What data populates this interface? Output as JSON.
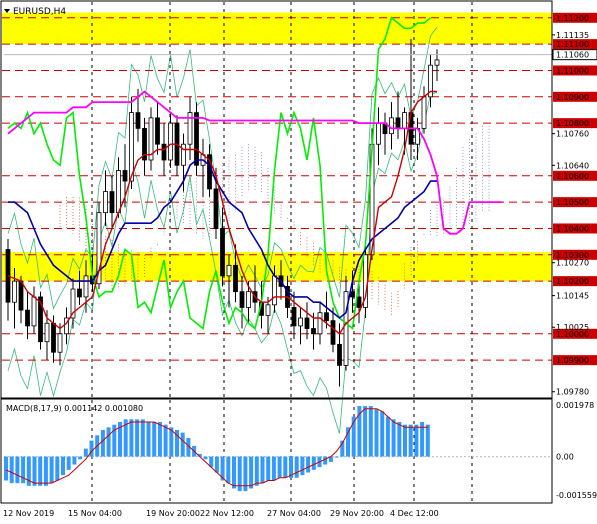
{
  "header": {
    "symbol": "EURUSD,H4"
  },
  "price_axis": {
    "ticks": [
      "1.11135",
      "1.10760",
      "1.10640",
      "1.10270",
      "1.10145",
      "1.10025",
      "1.09780"
    ],
    "current_price": "1.11060",
    "levels": [
      {
        "label": "1.11200",
        "value": 1.112
      },
      {
        "label": "1.11100",
        "value": 1.111
      },
      {
        "label": "1.11000",
        "value": 1.11
      },
      {
        "label": "1.10900",
        "value": 1.109
      },
      {
        "label": "1.10800",
        "value": 1.108
      },
      {
        "label": "1.10600",
        "value": 1.106
      },
      {
        "label": "1.10500",
        "value": 1.105
      },
      {
        "label": "1.10400",
        "value": 1.104
      },
      {
        "label": "1.10300",
        "value": 1.103
      },
      {
        "label": "1.10200",
        "value": 1.102
      },
      {
        "label": "1.10000",
        "value": 1.1
      },
      {
        "label": "1.09900",
        "value": 1.099
      }
    ],
    "highlight_zones": [
      {
        "from": 1.111,
        "to": 1.1122
      },
      {
        "from": 1.102,
        "to": 1.1031
      }
    ]
  },
  "macd": {
    "title": "MACD(8,17,9) 0.001142 0.001080",
    "ticks": [
      "0.001978",
      "0.00",
      "-0.001559"
    ]
  },
  "time_axis": {
    "labels": [
      "12 Nov 2019",
      "15 Nov 04:00",
      "19 Nov 20:00",
      "22 Nov 12:00",
      "27 Nov 04:00",
      "29 Nov 20:00",
      "4 Dec 12:00"
    ]
  },
  "colors": {
    "background": "#ffffff",
    "level_line": "#cc0000",
    "zone_fill": "#ffff00",
    "bull_bear_candle": "#000000",
    "ichimoku_tenkan": "#cc0000",
    "ichimoku_kijun": "#0000aa",
    "chikou": "#00ee00",
    "magenta_line": "#ff00ff",
    "envelope": "#33bb77",
    "cloud_red": "#e07a50",
    "cloud_blue": "#9999cc",
    "macd_hist": "#3399ff",
    "macd_signal": "#cc0000"
  },
  "chart_data": {
    "type": "candlestick",
    "symbol": "EURUSD",
    "timeframe": "H4",
    "candles": [
      [
        1.1032,
        1.1036,
        1.1005,
        1.1012
      ],
      [
        1.1012,
        1.1025,
        1.1002,
        1.102
      ],
      [
        1.102,
        1.1022,
        1.1004,
        1.1009
      ],
      [
        1.1009,
        1.1016,
        1.0998,
        1.1003
      ],
      [
        1.1003,
        1.1018,
        1.1,
        1.1014
      ],
      [
        1.1014,
        1.1016,
        1.0994,
        1.0997
      ],
      [
        1.0997,
        1.1009,
        1.099,
        1.1004
      ],
      [
        1.1004,
        1.1007,
        1.0989,
        1.0993
      ],
      [
        1.0993,
        1.1004,
        1.0988,
        1.1
      ],
      [
        1.1,
        1.101,
        1.0996,
        1.1006
      ],
      [
        1.1006,
        1.1021,
        1.1002,
        1.1017
      ],
      [
        1.1017,
        1.1024,
        1.1011,
        1.1014
      ],
      [
        1.1014,
        1.1028,
        1.1008,
        1.1022
      ],
      [
        1.1022,
        1.103,
        1.1016,
        1.1019
      ],
      [
        1.1019,
        1.105,
        1.1017,
        1.1046
      ],
      [
        1.1046,
        1.1062,
        1.1041,
        1.1054
      ],
      [
        1.1054,
        1.106,
        1.104,
        1.1046
      ],
      [
        1.1046,
        1.1067,
        1.1044,
        1.1062
      ],
      [
        1.1062,
        1.1072,
        1.1048,
        1.1058
      ],
      [
        1.1058,
        1.109,
        1.1055,
        1.1084
      ],
      [
        1.1084,
        1.1093,
        1.1073,
        1.1078
      ],
      [
        1.1078,
        1.1082,
        1.106,
        1.1066
      ],
      [
        1.1066,
        1.1086,
        1.1062,
        1.1082
      ],
      [
        1.1082,
        1.1088,
        1.1068,
        1.1072
      ],
      [
        1.1072,
        1.108,
        1.106,
        1.1066
      ],
      [
        1.1066,
        1.1084,
        1.1063,
        1.108
      ],
      [
        1.108,
        1.1083,
        1.106,
        1.1064
      ],
      [
        1.1064,
        1.1076,
        1.1054,
        1.1072
      ],
      [
        1.1072,
        1.109,
        1.1066,
        1.1084
      ],
      [
        1.1084,
        1.1088,
        1.106,
        1.1064
      ],
      [
        1.1064,
        1.1074,
        1.1052,
        1.1068
      ],
      [
        1.1068,
        1.1072,
        1.1052,
        1.1055
      ],
      [
        1.1055,
        1.1063,
        1.1036,
        1.104
      ],
      [
        1.104,
        1.1048,
        1.1018,
        1.1022
      ],
      [
        1.1022,
        1.103,
        1.101,
        1.1026
      ],
      [
        1.1026,
        1.1034,
        1.1012,
        1.1016
      ],
      [
        1.1016,
        1.1022,
        1.1002,
        1.101
      ],
      [
        1.101,
        1.102,
        1.1004,
        1.1016
      ],
      [
        1.1016,
        1.1026,
        1.1008,
        1.1012
      ],
      [
        1.1012,
        1.102,
        1.1002,
        1.1007
      ],
      [
        1.1007,
        1.1014,
        1.1,
        1.1011
      ],
      [
        1.1011,
        1.1026,
        1.1008,
        1.1022
      ],
      [
        1.1022,
        1.1028,
        1.1013,
        1.1018
      ],
      [
        1.1018,
        1.1022,
        1.1006,
        1.101
      ],
      [
        1.101,
        1.1016,
        1.0998,
        1.1003
      ],
      [
        1.1003,
        1.101,
        1.0996,
        1.1006
      ],
      [
        1.1006,
        1.1012,
        1.0998,
        1.1002
      ],
      [
        1.1002,
        1.1008,
        1.0994,
        1.1
      ],
      [
        1.1,
        1.1012,
        1.0996,
        1.1008
      ],
      [
        1.1008,
        1.1016,
        1.1002,
        1.1005
      ],
      [
        1.1005,
        1.101,
        1.0993,
        1.0996
      ],
      [
        1.0996,
        1.1004,
        1.098,
        1.0988
      ],
      [
        1.0988,
        1.1022,
        1.0986,
        1.1016
      ],
      [
        1.1016,
        1.1024,
        1.1008,
        1.1014
      ],
      [
        1.1014,
        1.102,
        1.1004,
        1.101
      ],
      [
        1.101,
        1.1034,
        1.1006,
        1.103
      ],
      [
        1.103,
        1.1078,
        1.1028,
        1.1072
      ],
      [
        1.1072,
        1.1086,
        1.1064,
        1.108
      ],
      [
        1.108,
        1.1084,
        1.1068,
        1.1076
      ],
      [
        1.1076,
        1.1088,
        1.107,
        1.1082
      ],
      [
        1.1082,
        1.1092,
        1.1074,
        1.1078
      ],
      [
        1.1078,
        1.1086,
        1.1068,
        1.1084
      ],
      [
        1.1084,
        1.1112,
        1.1066,
        1.1072
      ],
      [
        1.1072,
        1.1082,
        1.1066,
        1.1078
      ],
      [
        1.1078,
        1.1094,
        1.1076,
        1.109
      ],
      [
        1.109,
        1.1106,
        1.1086,
        1.1102
      ],
      [
        1.1102,
        1.1108,
        1.1096,
        1.1104
      ]
    ],
    "tenkan_sen": [
      1.1022,
      1.1021,
      1.102,
      1.1016,
      1.1014,
      1.1012,
      1.1006,
      1.1004,
      1.1002,
      1.1004,
      1.1008,
      1.101,
      1.1012,
      1.1014,
      1.1024,
      1.1034,
      1.104,
      1.1046,
      1.1052,
      1.106,
      1.1066,
      1.1068,
      1.1068,
      1.107,
      1.107,
      1.1072,
      1.1072,
      1.107,
      1.107,
      1.107,
      1.1068,
      1.1066,
      1.106,
      1.105,
      1.104,
      1.1032,
      1.1024,
      1.1018,
      1.1014,
      1.1012,
      1.1012,
      1.1014,
      1.1014,
      1.1014,
      1.1012,
      1.101,
      1.1008,
      1.1006,
      1.1006,
      1.1004,
      1.1002,
      1.1,
      1.1004,
      1.1006,
      1.1008,
      1.1014,
      1.1032,
      1.1048,
      1.105,
      1.1052,
      1.106,
      1.107,
      1.1084,
      1.1088,
      1.109,
      1.1092,
      1.1092
    ],
    "kijun_sen": [
      1.105,
      1.105,
      1.1048,
      1.1046,
      1.104,
      1.1034,
      1.103,
      1.1026,
      1.1024,
      1.1022,
      1.102,
      1.102,
      1.102,
      1.102,
      1.1024,
      1.1026,
      1.1032,
      1.1038,
      1.1042,
      1.1042,
      1.1042,
      1.1042,
      1.1042,
      1.1044,
      1.1048,
      1.105,
      1.1054,
      1.1058,
      1.1064,
      1.1066,
      1.1066,
      1.1064,
      1.1058,
      1.1054,
      1.105,
      1.1048,
      1.1046,
      1.104,
      1.1036,
      1.1032,
      1.1026,
      1.1022,
      1.102,
      1.1016,
      1.1014,
      1.1014,
      1.1014,
      1.1012,
      1.1012,
      1.101,
      1.1008,
      1.1006,
      1.1008,
      1.102,
      1.1028,
      1.1032,
      1.1036,
      1.1038,
      1.104,
      1.1042,
      1.1044,
      1.1048,
      1.105,
      1.1052,
      1.1054,
      1.1058,
      1.1058
    ],
    "magenta_line": [
      1.1076,
      1.1078,
      1.108,
      1.1082,
      1.1084,
      1.1084,
      1.1084,
      1.1084,
      1.1084,
      1.1084,
      1.1086,
      1.1086,
      1.1086,
      1.1088,
      1.1088,
      1.1088,
      1.1088,
      1.1088,
      1.1088,
      1.1088,
      1.109,
      1.1092,
      1.109,
      1.1088,
      1.1086,
      1.1084,
      1.1082,
      1.1082,
      1.1082,
      1.1082,
      1.1082,
      1.1081,
      1.1081,
      1.1081,
      1.1081,
      1.1081,
      1.1081,
      1.1081,
      1.1081,
      1.1081,
      1.1081,
      1.1081,
      1.1081,
      1.1081,
      1.1081,
      1.1081,
      1.1081,
      1.1081,
      1.1081,
      1.1081,
      1.1081,
      1.1081,
      1.1081,
      1.1081,
      1.108,
      1.108,
      1.108,
      1.108,
      1.108,
      1.1078,
      1.1078,
      1.1078,
      1.1078,
      1.1078,
      1.1074,
      1.1068,
      1.106,
      1.104,
      1.1038,
      1.1038,
      1.104,
      1.105,
      1.105,
      1.105,
      1.105,
      1.105,
      1.105
    ],
    "chikou_span": [
      1.1078,
      1.108,
      1.1078,
      1.1084,
      1.1076,
      1.108,
      1.1072,
      1.1066,
      1.1064,
      1.1082,
      1.1084,
      1.106,
      1.1044,
      1.1022,
      1.1014,
      1.1016,
      1.1016,
      1.1022,
      1.1032,
      1.103,
      1.101,
      1.1012,
      1.1008,
      1.1018,
      1.1028,
      1.101,
      1.1016,
      1.102,
      1.1006,
      1.1004,
      1.1002,
      1.1016,
      1.1024,
      1.1012,
      1.1004,
      1.101,
      1.1008,
      1.1004,
      1.1002,
      1.1012,
      1.103,
      1.1062,
      1.1084,
      1.1076,
      1.1084,
      1.1078,
      1.1066,
      1.1082,
      1.1064,
      1.1024,
      1.1012,
      1.1006,
      1.1004,
      1.1002,
      1.102,
      1.1034,
      1.107,
      1.1108,
      1.1112,
      1.112,
      1.1118,
      1.1116,
      1.1116,
      1.1118,
      1.1118,
      1.112
    ],
    "macd_histogram": [
      -0.0009,
      -0.001,
      -0.001,
      -0.001,
      -0.0011,
      -0.0011,
      -0.0011,
      -0.0011,
      -0.001,
      -0.0009,
      -0.0007,
      -0.0005,
      -0.0003,
      -0.0001,
      0.0003,
      0.0006,
      0.0008,
      0.001,
      0.0011,
      0.0012,
      0.0013,
      0.0014,
      0.0014,
      0.0014,
      0.0014,
      0.0013,
      0.0013,
      0.0013,
      0.0012,
      0.0011,
      0.001,
      0.0009,
      0.0007,
      0.0004,
      0.0001,
      -0.0001,
      -0.0004,
      -0.0006,
      -0.0009,
      -0.001,
      -0.0012,
      -0.0013,
      -0.0013,
      -0.0012,
      -0.0011,
      -0.001,
      -0.0009,
      -0.0009,
      -0.0008,
      -0.0008,
      -0.0008,
      -0.0008,
      -0.0007,
      -0.0006,
      -0.0005,
      -0.0004,
      -0.0003,
      -0.0002,
      0.0,
      0.0006,
      0.0011,
      0.0015,
      0.0019,
      0.0019,
      0.0019,
      0.0018,
      0.0017,
      0.0015,
      0.0014,
      0.0013,
      0.0012,
      0.0012,
      0.0012,
      0.0013,
      0.0012
    ],
    "macd_signal": [
      -0.0005,
      -0.0006,
      -0.0007,
      -0.0008,
      -0.0009,
      -0.001,
      -0.001,
      -0.001,
      -0.001,
      -0.0009,
      -0.0008,
      -0.0007,
      -0.0005,
      -0.0003,
      -0.0001,
      0.0002,
      0.0004,
      0.0006,
      0.0008,
      0.001,
      0.0011,
      0.0012,
      0.0013,
      0.0013,
      0.0013,
      0.0013,
      0.0013,
      0.0012,
      0.0011,
      0.001,
      0.0008,
      0.0006,
      0.0004,
      0.0002,
      0.0,
      -0.0002,
      -0.0004,
      -0.0006,
      -0.0008,
      -0.001,
      -0.0011,
      -0.0011,
      -0.0011,
      -0.0011,
      -0.001,
      -0.001,
      -0.0009,
      -0.0009,
      -0.0008,
      -0.0008,
      -0.0007,
      -0.0006,
      -0.0005,
      -0.0004,
      -0.0003,
      -0.0002,
      -0.0001,
      0.0,
      0.0002,
      0.0005,
      0.0009,
      0.0013,
      0.0016,
      0.0018,
      0.0018,
      0.0018,
      0.0017,
      0.0015,
      0.0013,
      0.0012,
      0.0011,
      0.0011,
      0.0011,
      0.0011,
      0.0011
    ],
    "macd_ylim": [
      -0.001559,
      0.001978
    ],
    "price_ylim": [
      1.0976,
      1.1126
    ]
  }
}
